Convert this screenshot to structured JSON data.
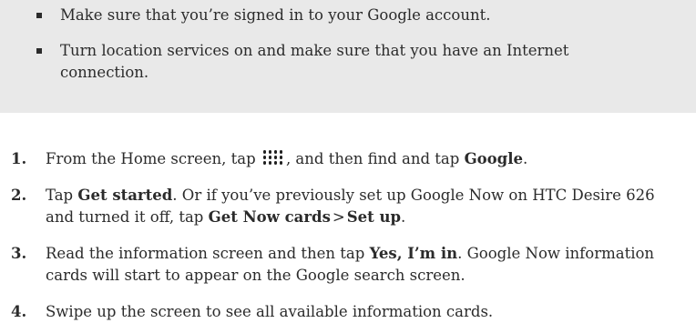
{
  "prerequisites": {
    "items": [
      {
        "text": "Make sure that you’re signed in to your Google account."
      },
      {
        "text": "Turn location services on and make sure that you have an Internet connection."
      }
    ]
  },
  "steps": [
    {
      "number": "1.",
      "text_before": "From the Home screen, tap ",
      "icon": "apps-grid-icon",
      "text_middle": ", and then find and tap ",
      "bold_1": "Google",
      "text_end": "."
    },
    {
      "number": "2.",
      "text_before": "Tap ",
      "bold_1": "Get started",
      "text_middle": ". Or if you’ve previously set up Google Now on HTC Desire 626 and turned it off, tap ",
      "bold_2": "Get Now cards",
      "separator": ">",
      "bold_3": "Set up",
      "text_end": "."
    },
    {
      "number": "3.",
      "text_before": "Read the information screen and then tap ",
      "bold_1": "Yes, I’m in",
      "text_end": ". Google Now information cards will start to appear on the Google search screen."
    },
    {
      "number": "4.",
      "text_before": "Swipe up the screen to see all available information cards."
    }
  ]
}
